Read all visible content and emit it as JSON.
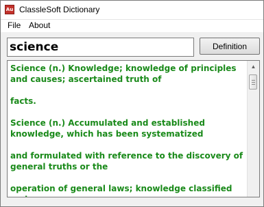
{
  "window": {
    "title": "ClassleSoft Dictionary",
    "app_icon_text": "Au",
    "app_icon": "book-app-icon"
  },
  "menu": {
    "file": "File",
    "about": "About"
  },
  "search": {
    "value": "science"
  },
  "button": {
    "definition": "Definition"
  },
  "result": {
    "color": "#1a8a1a",
    "lines": [
      "Science (n.) Knowledge; knowledge of principles and causes; ascertained truth of",
      "facts.",
      "Science (n.) Accumulated and established knowledge, which has been systematized",
      "and formulated with reference to the discovery of general truths or the",
      "operation of general laws; knowledge classified and"
    ]
  },
  "scrollbar": {
    "up_arrow": "scroll-up-arrow"
  }
}
